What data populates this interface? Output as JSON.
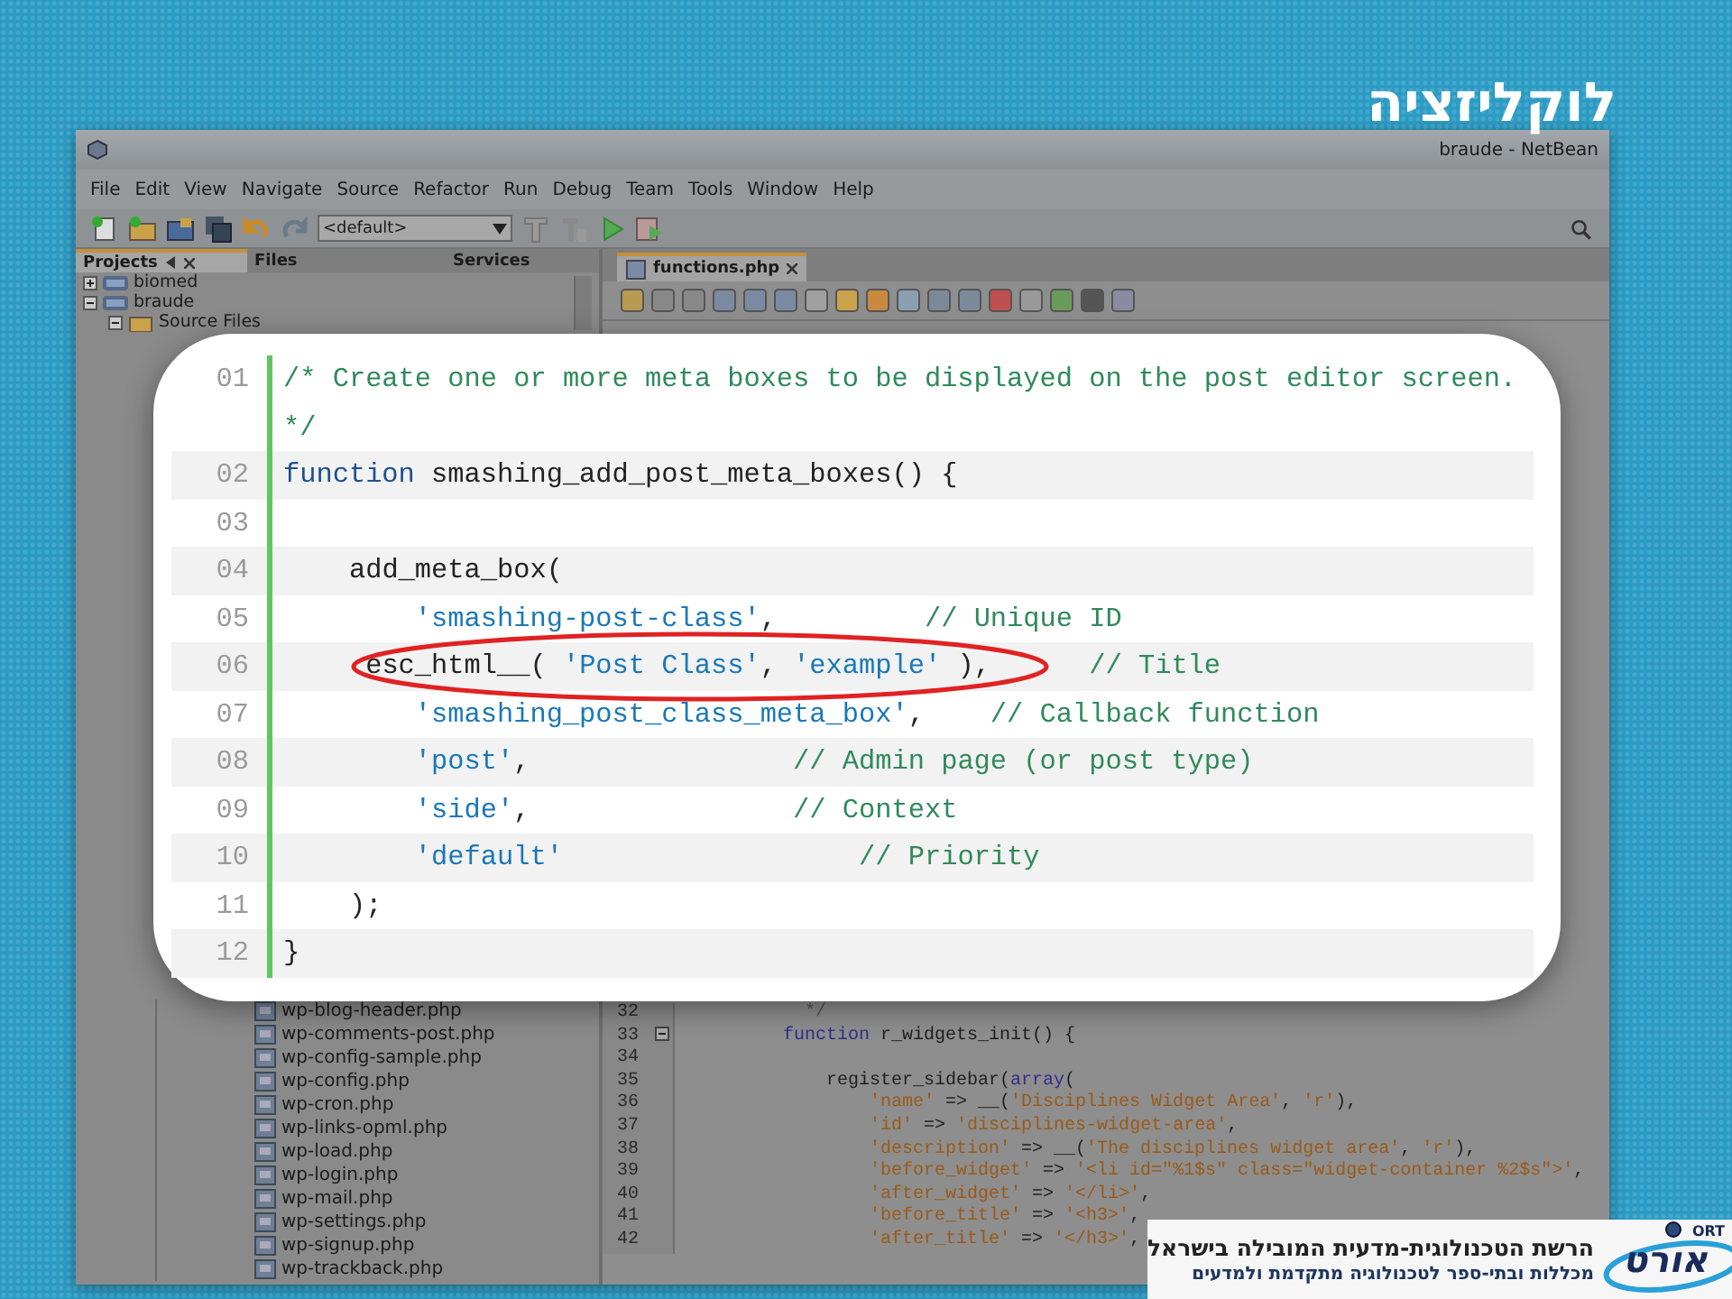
{
  "title": "לוקליזציה",
  "ide": {
    "window_title": "braude - NetBean",
    "menu": [
      "File",
      "Edit",
      "View",
      "Navigate",
      "Source",
      "Refactor",
      "Run",
      "Debug",
      "Team",
      "Tools",
      "Window",
      "Help"
    ],
    "config_dropdown": "<default>",
    "panel_tabs": [
      {
        "label": "Projects",
        "selected": true
      },
      {
        "label": "Files",
        "selected": false
      },
      {
        "label": "Services",
        "selected": false
      }
    ],
    "projects": [
      {
        "label": "biomed",
        "expanded": false
      },
      {
        "label": "braude",
        "expanded": true,
        "children": [
          {
            "label": "Source Files",
            "expanded": true
          }
        ]
      }
    ],
    "files": [
      "wp-blog-header.php",
      "wp-comments-post.php",
      "wp-config-sample.php",
      "wp-config.php",
      "wp-cron.php",
      "wp-links-opml.php",
      "wp-load.php",
      "wp-login.php",
      "wp-mail.php",
      "wp-settings.php",
      "wp-signup.php",
      "wp-trackback.php"
    ],
    "editor_tabs": [
      {
        "label": "functions.php",
        "selected": true
      }
    ],
    "code_lines": [
      {
        "number": "32",
        "foldable": false,
        "tokens": [
          {
            "kind": "comment",
            "text": "          */"
          }
        ]
      },
      {
        "number": "33",
        "foldable": true,
        "tokens": [
          {
            "kind": "keyword",
            "text": "        function"
          },
          {
            "kind": "plain",
            "text": " r_widgets_init() {"
          }
        ]
      },
      {
        "number": "34",
        "foldable": false
      },
      {
        "number": "35",
        "foldable": false,
        "tokens": [
          {
            "kind": "plain",
            "text": "            register_sidebar("
          },
          {
            "kind": "keyword",
            "text": "array"
          },
          {
            "kind": "plain",
            "text": "("
          }
        ]
      },
      {
        "number": "36",
        "foldable": false,
        "tokens": [
          {
            "kind": "string",
            "text": "                'name'"
          },
          {
            "kind": "plain",
            "text": " => __("
          },
          {
            "kind": "string",
            "text": "'Disciplines Widget Area'"
          },
          {
            "kind": "plain",
            "text": ", "
          },
          {
            "kind": "string",
            "text": "'r'"
          },
          {
            "kind": "plain",
            "text": "),"
          }
        ]
      },
      {
        "number": "37",
        "foldable": false,
        "tokens": [
          {
            "kind": "string",
            "text": "                'id'"
          },
          {
            "kind": "plain",
            "text": " => "
          },
          {
            "kind": "string",
            "text": "'disciplines-widget-area'"
          },
          {
            "kind": "plain",
            "text": ","
          }
        ]
      },
      {
        "number": "38",
        "foldable": false,
        "tokens": [
          {
            "kind": "string",
            "text": "                'description'"
          },
          {
            "kind": "plain",
            "text": " => __("
          },
          {
            "kind": "string",
            "text": "'The disciplines widget area'"
          },
          {
            "kind": "plain",
            "text": ", "
          },
          {
            "kind": "string",
            "text": "'r'"
          },
          {
            "kind": "plain",
            "text": "),"
          }
        ]
      },
      {
        "number": "39",
        "foldable": false,
        "tokens": [
          {
            "kind": "string",
            "text": "                'before_widget'"
          },
          {
            "kind": "plain",
            "text": " => "
          },
          {
            "kind": "string",
            "text": "'<li id=\"%1$s\" class=\"widget-container %2$s\">'"
          },
          {
            "kind": "plain",
            "text": ","
          }
        ]
      },
      {
        "number": "40",
        "foldable": false,
        "tokens": [
          {
            "kind": "string",
            "text": "                'after_widget'"
          },
          {
            "kind": "plain",
            "text": " => "
          },
          {
            "kind": "string",
            "text": "'</li>'"
          },
          {
            "kind": "plain",
            "text": ","
          }
        ]
      },
      {
        "number": "41",
        "foldable": false,
        "tokens": [
          {
            "kind": "string",
            "text": "                'before_title'"
          },
          {
            "kind": "plain",
            "text": " => "
          },
          {
            "kind": "string",
            "text": "'<h3>'"
          },
          {
            "kind": "plain",
            "text": ","
          }
        ]
      },
      {
        "number": "42",
        "foldable": false,
        "tokens": [
          {
            "kind": "string",
            "text": "                'after_title'"
          },
          {
            "kind": "plain",
            "text": " => "
          },
          {
            "kind": "string",
            "text": "'</h3>'"
          },
          {
            "kind": "plain",
            "text": ","
          }
        ]
      }
    ]
  },
  "code_card": {
    "lines": [
      {
        "number": "01",
        "circled": false,
        "tokens": [
          {
            "kind": "comment",
            "text": "/* Create one or more meta boxes to be displayed on the post editor screen. */"
          }
        ]
      },
      {
        "number": "02",
        "circled": false,
        "tokens": [
          {
            "kind": "keyword",
            "text": "function"
          },
          {
            "kind": "plain",
            "text": " smashing_add_post_meta_boxes() {"
          }
        ]
      },
      {
        "number": "03",
        "circled": false
      },
      {
        "number": "04",
        "circled": false,
        "tokens": [
          {
            "kind": "plain",
            "text": "    add_meta_box("
          }
        ]
      },
      {
        "number": "05",
        "circled": false,
        "tokens": [
          {
            "kind": "string",
            "text": "        'smashing-post-class'"
          },
          {
            "kind": "plain",
            "text": ","
          },
          {
            "kind": "comment",
            "text": "         // Unique ID"
          }
        ]
      },
      {
        "number": "06",
        "circled": true,
        "tokens": [
          {
            "kind": "plain",
            "text": "     esc_html__( "
          },
          {
            "kind": "string",
            "text": "'Post Class'"
          },
          {
            "kind": "plain",
            "text": ", "
          },
          {
            "kind": "string",
            "text": "'example'"
          },
          {
            "kind": "plain",
            "text": " ),"
          },
          {
            "kind": "comment",
            "text": "      // Title"
          }
        ]
      },
      {
        "number": "07",
        "circled": false,
        "tokens": [
          {
            "kind": "string",
            "text": "        'smashing_post_class_meta_box'"
          },
          {
            "kind": "plain",
            "text": ","
          },
          {
            "kind": "comment",
            "text": "    // Callback function"
          }
        ]
      },
      {
        "number": "08",
        "circled": false,
        "tokens": [
          {
            "kind": "string",
            "text": "        'post'"
          },
          {
            "kind": "plain",
            "text": ","
          },
          {
            "kind": "comment",
            "text": "                // Admin page (or post type)"
          }
        ]
      },
      {
        "number": "09",
        "circled": false,
        "tokens": [
          {
            "kind": "string",
            "text": "        'side'"
          },
          {
            "kind": "plain",
            "text": ","
          },
          {
            "kind": "comment",
            "text": "                // Context"
          }
        ]
      },
      {
        "number": "10",
        "circled": false,
        "tokens": [
          {
            "kind": "string",
            "text": "        'default'"
          },
          {
            "kind": "comment",
            "text": "                  // Priority"
          }
        ]
      },
      {
        "number": "11",
        "circled": false,
        "tokens": [
          {
            "kind": "plain",
            "text": "    );"
          }
        ]
      },
      {
        "number": "12",
        "circled": false,
        "tokens": [
          {
            "kind": "plain",
            "text": "}"
          }
        ]
      }
    ]
  },
  "footer": {
    "tagline": "הרשת הטכנולוגית-מדעית המובילה בישראל",
    "subtitle": "מכללות ובתי-ספר לטכנולוגיה מתקדמת ולמדעים",
    "logo_text": "אורט",
    "logo_latin": "ORT"
  }
}
